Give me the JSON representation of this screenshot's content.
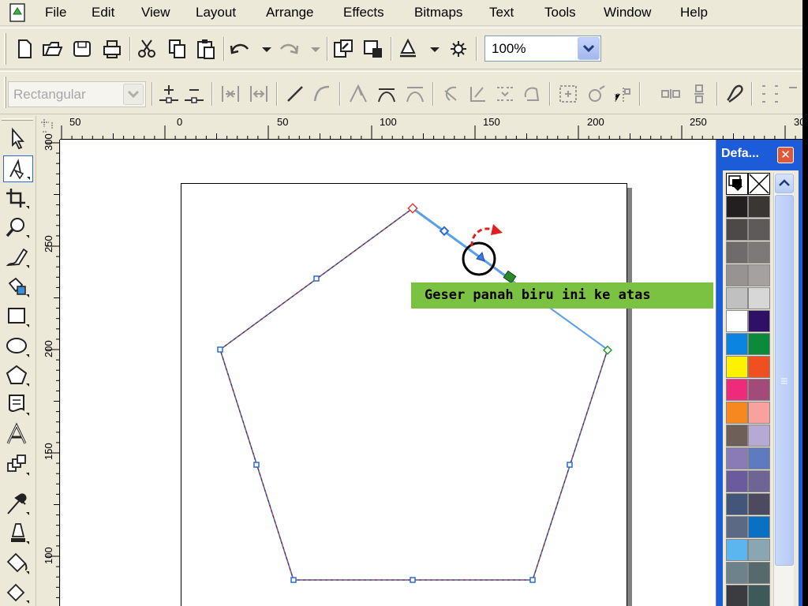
{
  "menu": [
    "File",
    "Edit",
    "View",
    "Layout",
    "Arrange",
    "Effects",
    "Bitmaps",
    "Text",
    "Tools",
    "Window",
    "Help"
  ],
  "zoom": {
    "value": "100%"
  },
  "property_bar": {
    "shape_mode": "Rectangular"
  },
  "ruler": {
    "horizontal": [
      "50",
      "0",
      "50",
      "100",
      "150",
      "200",
      "250",
      "30"
    ],
    "vertical": [
      "300",
      "250",
      "200",
      "150",
      "100"
    ]
  },
  "instruction": "Geser panah biru ini ke atas",
  "palette": {
    "title": "Defa...",
    "close": "✕",
    "swatches": [
      [
        "#231f20",
        "#3a3633"
      ],
      [
        "#4d4948",
        "#5e5a59"
      ],
      [
        "#6f6b6a",
        "#7d7978"
      ],
      [
        "#979392",
        "#a5a1a0"
      ],
      [
        "#c0c0c0",
        "#d7d7d7"
      ],
      [
        "#ffffff",
        "#2e1065"
      ],
      [
        "#0a84e0",
        "#0b8a3c"
      ],
      [
        "#fff200",
        "#f05021"
      ],
      [
        "#ee2a7b",
        "#a34b78"
      ],
      [
        "#f7881f",
        "#f8a19e"
      ],
      [
        "#6e6058",
        "#b6aad5"
      ],
      [
        "#8a7ab6",
        "#5f7bbf"
      ],
      [
        "#6b5a9e",
        "#6e6594"
      ],
      [
        "#44557a",
        "#4c4a5e"
      ],
      [
        "#5b6985",
        "#0871c4"
      ],
      [
        "#5bb6ef",
        "#8aa6b3"
      ],
      [
        "#6e828c",
        "#566a6e"
      ],
      [
        "#3a3c40",
        "#3d5a58"
      ]
    ]
  }
}
